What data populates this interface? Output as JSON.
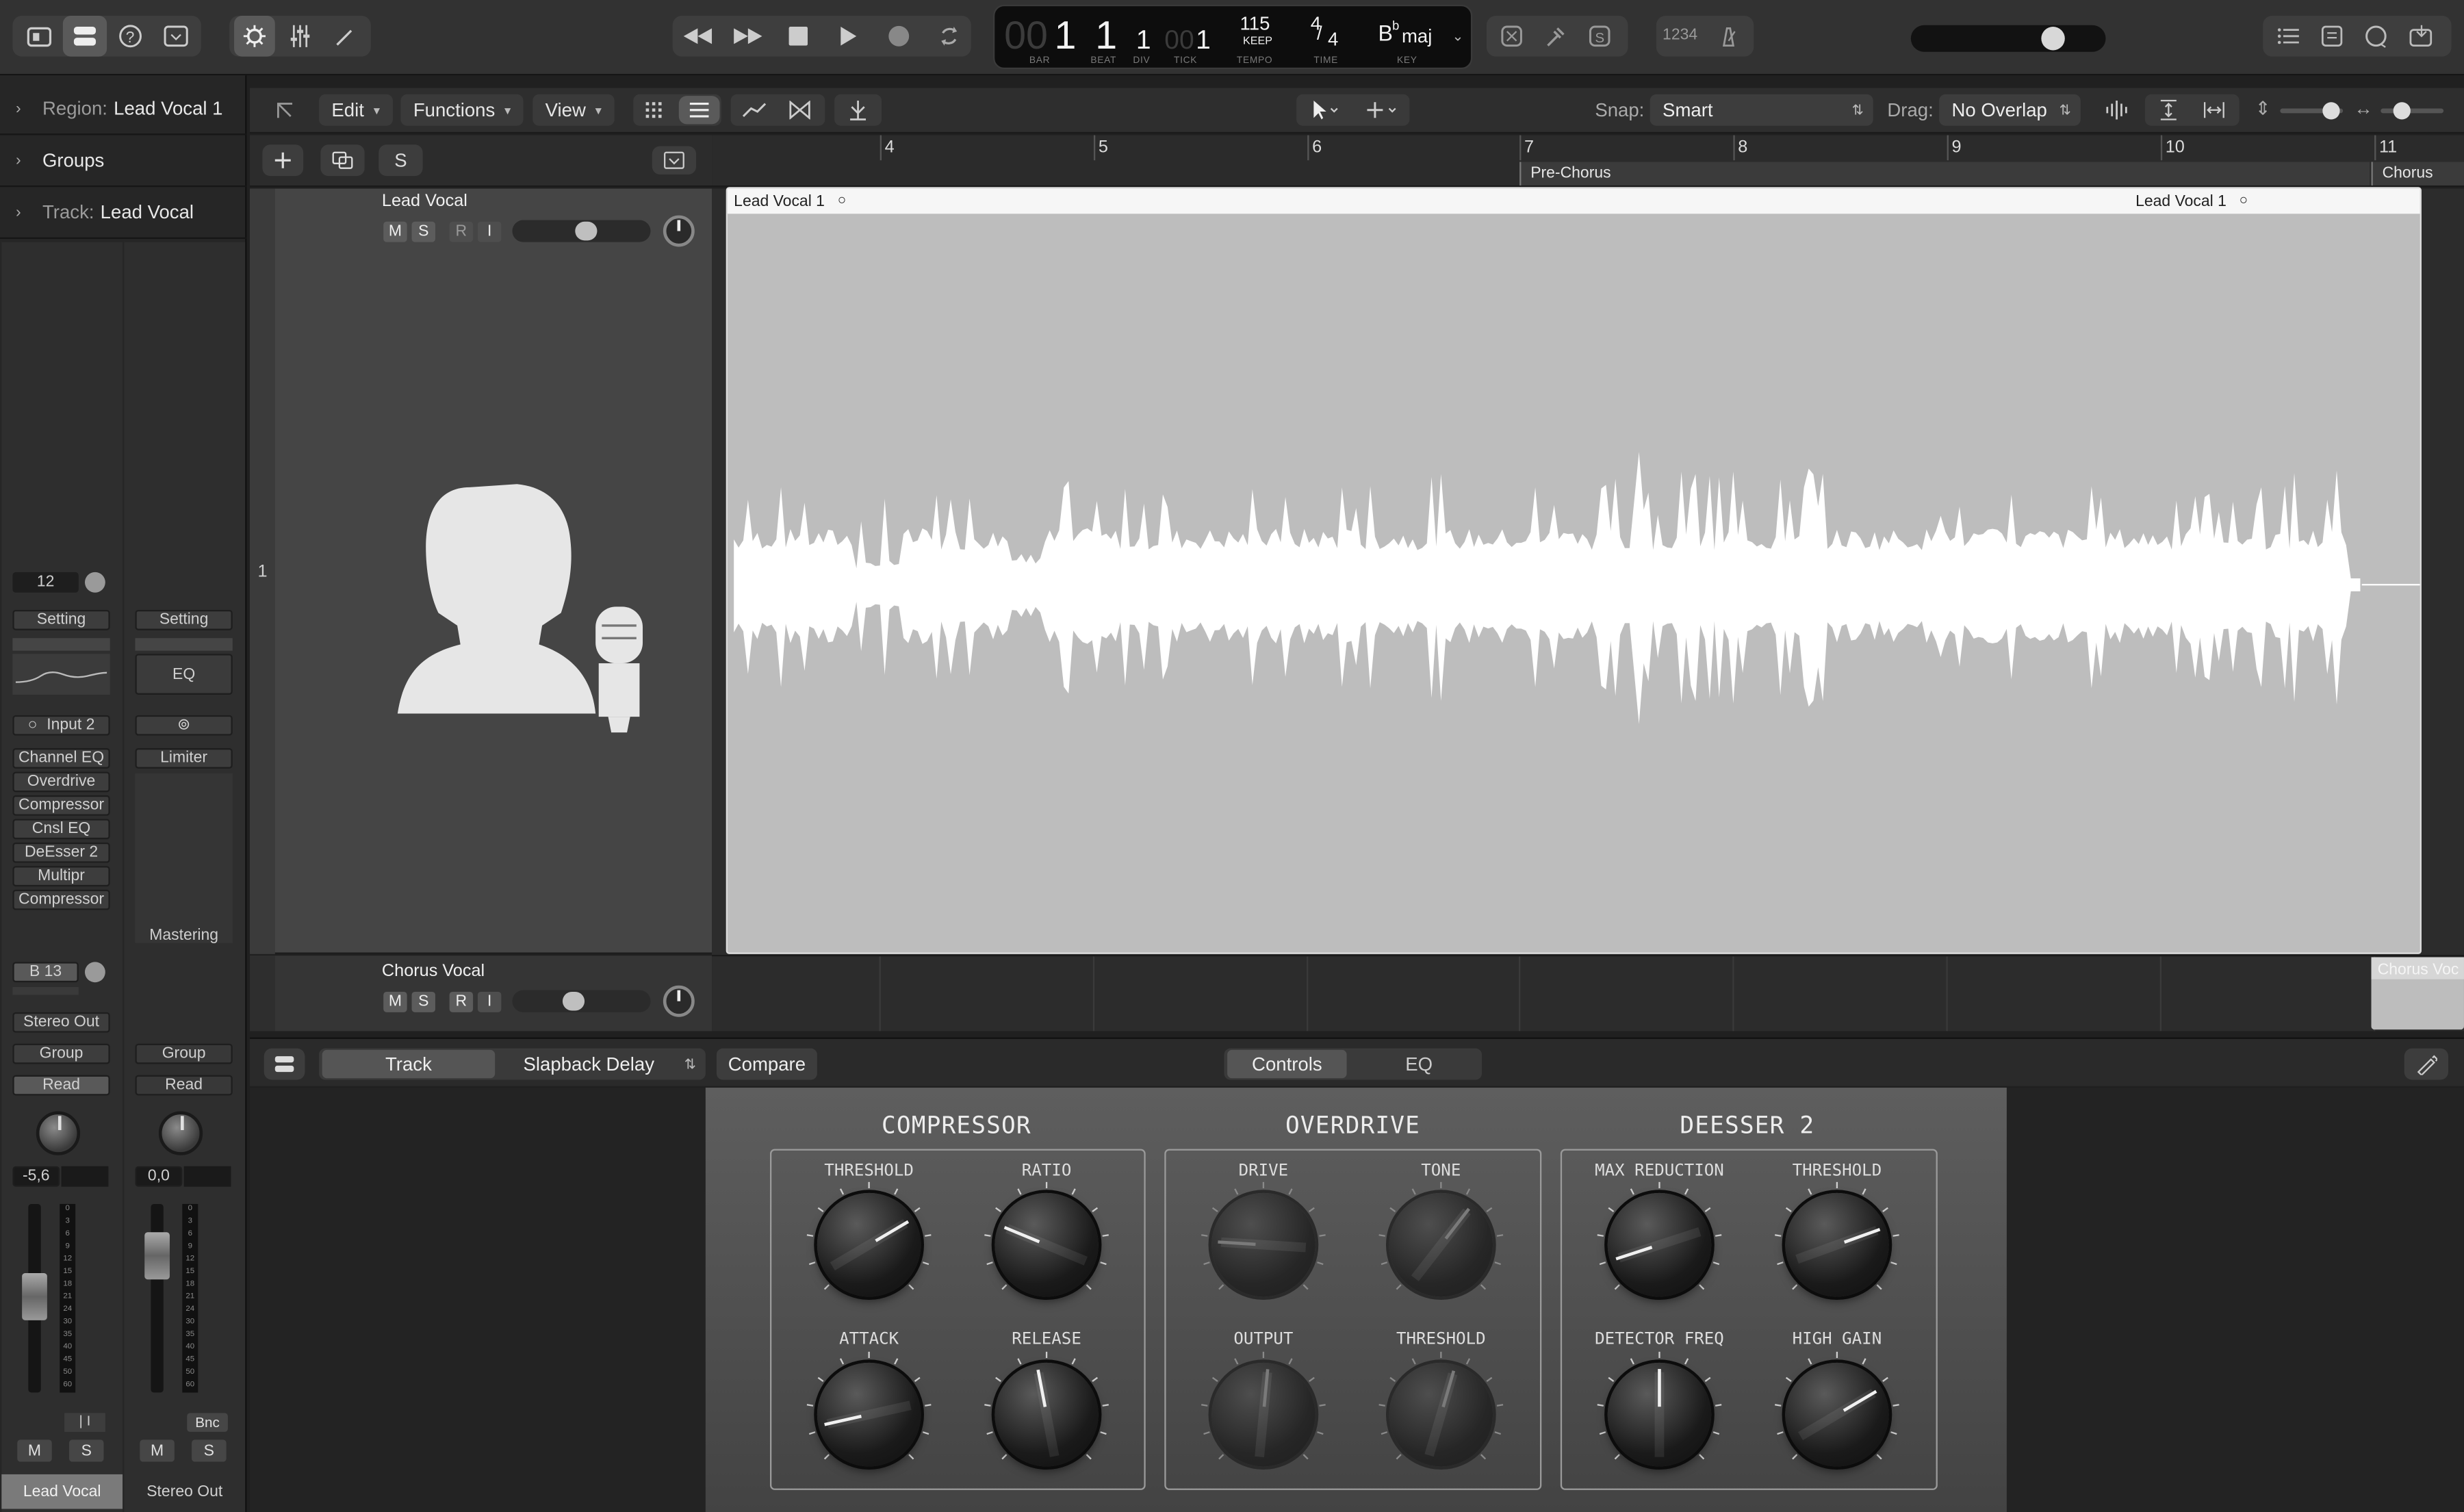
{
  "control_bar": {
    "lcd": {
      "bar_dim": "00",
      "bar": "1",
      "beat": "1",
      "div": "1",
      "tick_dim": "00",
      "tick": "1",
      "bar_label": "BAR",
      "beat_label": "BEAT",
      "div_label": "DIV",
      "tick_label": "TICK",
      "tempo": "115",
      "tempo_mode": "KEEP",
      "tempo_label": "TEMPO",
      "sig_top": "4",
      "sig_bottom": "4",
      "time_label": "TIME",
      "key_root": "B",
      "key_acc": "b",
      "key_mode": "maj",
      "key_label": "KEY"
    },
    "count_in": "1234",
    "master_volume_level": 0.78
  },
  "inspector": {
    "region_label": "Region:",
    "region_value": "Lead Vocal 1",
    "groups_label": "Groups",
    "track_label": "Track:",
    "track_value": "Lead Vocal",
    "strip1": {
      "gain": "12",
      "setting": "Setting",
      "input": "Input 2",
      "plugins": [
        "Channel EQ",
        "Overdrive",
        "Compressor",
        "Cnsl EQ",
        "DeEsser 2",
        "Multipr",
        "Compressor"
      ],
      "send": "B 13",
      "output": "Stereo Out",
      "group": "Group",
      "automation": "Read",
      "volume": "-5,6",
      "mute": "M",
      "solo": "S",
      "name": "Lead Vocal",
      "meter_scale": [
        "0",
        "3",
        "6",
        "9",
        "12",
        "15",
        "18",
        "21",
        "24",
        "30",
        "35",
        "40",
        "45",
        "50",
        "60"
      ]
    },
    "strip2": {
      "setting": "Setting",
      "eq": "EQ",
      "plugins": [
        "Limiter"
      ],
      "footer_label": "Mastering",
      "group": "Group",
      "automation": "Read",
      "volume": "0,0",
      "bounce": "Bnc",
      "mute": "M",
      "solo": "S",
      "name": "Stereo Out"
    }
  },
  "editor_bar": {
    "edit": "Edit",
    "functions": "Functions",
    "view": "View",
    "snap_label": "Snap:",
    "snap_value": "Smart",
    "drag_label": "Drag:",
    "drag_value": "No Overlap"
  },
  "ruler": {
    "bars": [
      "4",
      "5",
      "6",
      "7",
      "8",
      "9",
      "10",
      "11"
    ],
    "markers": [
      "Pre-Chorus",
      "Chorus"
    ]
  },
  "track_header_bar": {
    "solo_all": "S"
  },
  "tracks": [
    {
      "number": "1",
      "name": "Lead Vocal",
      "m": "M",
      "s": "S",
      "r": "R",
      "i": "I",
      "volume_level": 0.55
    },
    {
      "number": "",
      "name": "Chorus Vocal",
      "m": "M",
      "s": "S",
      "r": "R",
      "i": "I",
      "volume_level": 0.45
    }
  ],
  "regions": {
    "main_left_name": "Lead Vocal 1",
    "main_right_name": "Lead Vocal 1",
    "chorus_name": "Chorus Voc"
  },
  "smart_controls": {
    "tab_track": "Track",
    "patch": "Slapback Delay",
    "compare": "Compare",
    "view_controls": "Controls",
    "view_eq": "EQ",
    "sections": [
      {
        "title": "COMPRESSOR",
        "knobs": [
          {
            "label": "THRESHOLD",
            "value": 0.72
          },
          {
            "label": "RATIO",
            "value": 0.25
          },
          {
            "label": "ATTACK",
            "value": 0.12
          },
          {
            "label": "RELEASE",
            "value": 0.46
          }
        ]
      },
      {
        "title": "OVERDRIVE",
        "knobs": [
          {
            "label": "DRIVE",
            "value": 0.18
          },
          {
            "label": "TONE",
            "value": 0.64
          },
          {
            "label": "OUTPUT",
            "value": 0.52
          },
          {
            "label": "THRESHOLD",
            "value": 0.56
          }
        ]
      },
      {
        "title": "DEESSER 2",
        "knobs": [
          {
            "label": "MAX REDUCTION",
            "value": 0.1
          },
          {
            "label": "THRESHOLD",
            "value": 0.76
          },
          {
            "label": "DETECTOR FREQ",
            "value": 0.5
          },
          {
            "label": "HIGH GAIN",
            "value": 0.72
          }
        ]
      }
    ]
  }
}
